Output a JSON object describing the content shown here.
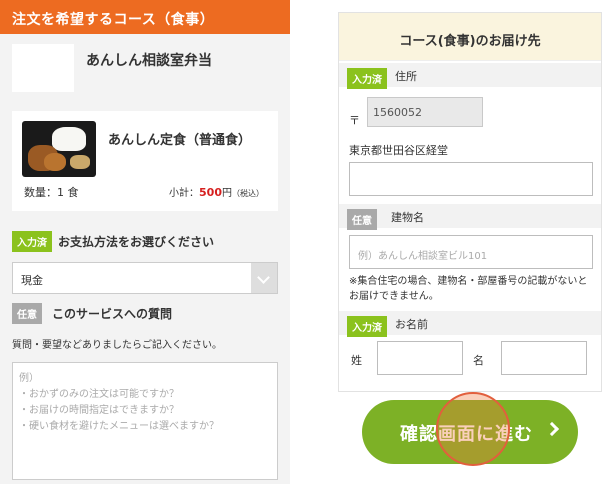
{
  "left": {
    "header_title": "注文を希望するコース（食事）",
    "shop_name": "あんしん相談室弁当",
    "item": {
      "name": "あんしん定食（普通食）",
      "quantity_text": "数量：1 食",
      "subtotal_label": "小計：",
      "price": "500",
      "price_unit": "円",
      "tax_note": "（税込）"
    },
    "payment": {
      "badge": "入力済",
      "label": "お支払方法をお選びください",
      "selected": "現金"
    },
    "question": {
      "badge": "任意",
      "label": "このサービスへの質問",
      "note": "質問・要望などありましたらご記入ください。",
      "placeholder_lines": [
        "例）",
        "・おかずのみの注文は可能ですか？",
        "・お届けの時間指定はできますか？",
        "・硬い食材を避けたメニューは選べますか？"
      ]
    }
  },
  "right": {
    "header_title": "コース(食事)のお届け先",
    "address": {
      "badge": "入力済",
      "label": "住所",
      "zip_mark": "〒",
      "zip_value": "1560052",
      "address_text": "東京都世田谷区経堂",
      "address_detail_value": ""
    },
    "building": {
      "badge": "任意",
      "label": "建物名",
      "placeholder": "例）あんしん相談室ビル101",
      "note": "※集合住宅の場合、建物名・部屋番号の記載がないとお届けできません。"
    },
    "name": {
      "badge": "入力済",
      "label": "お名前",
      "sei_label": "姓",
      "mei_label": "名",
      "sei_value": "",
      "mei_value": ""
    }
  },
  "next_button": {
    "label": "確認画面に進む"
  },
  "colors": {
    "header_orange": "#ed6b21",
    "badge_done": "#8bc21d",
    "badge_optional": "#a9a9a9",
    "price_red": "#d6201f",
    "button_green": "#7db126",
    "right_header_bg": "#faf4de"
  }
}
